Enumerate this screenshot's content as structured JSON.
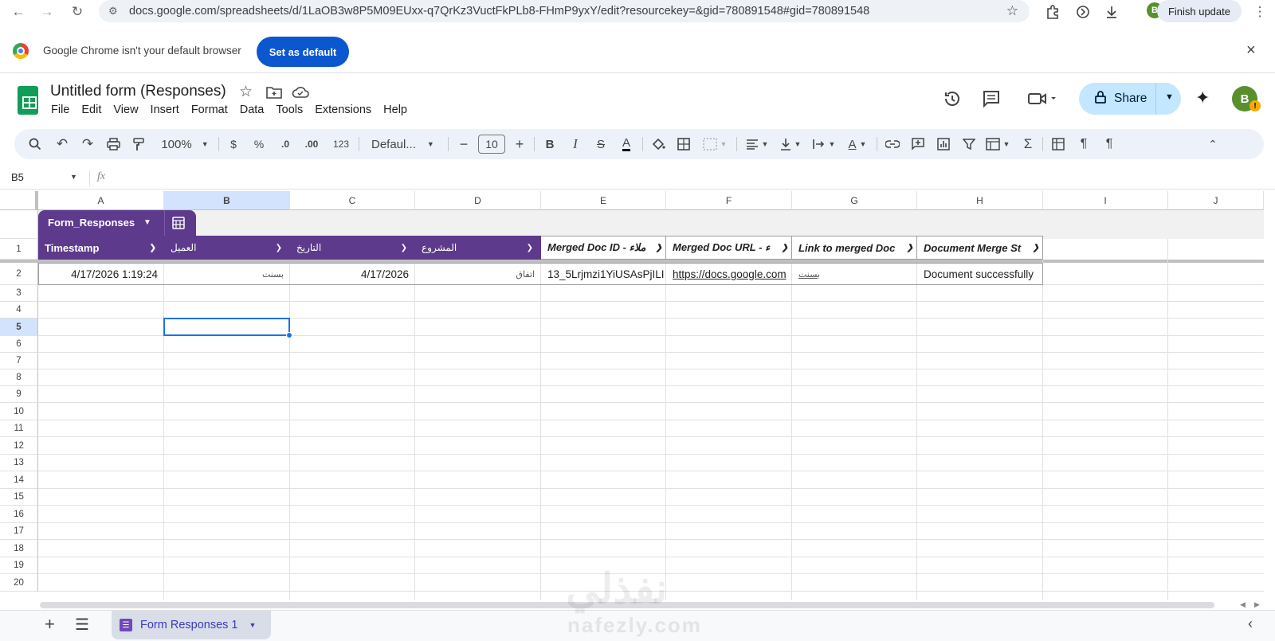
{
  "browser": {
    "url": "docs.google.com/spreadsheets/d/1LaOB3w8P5M09EUxx-q7QrKz3VuctFkPLb8-FHmP9yxY/edit?resourcekey=&gid=780891548#gid=780891548",
    "profile_initial": "B",
    "finish_update_label": "Finish update",
    "infobar_text": "Google Chrome isn't your default browser",
    "set_default_label": "Set as default"
  },
  "sheets": {
    "doc_title": "Untitled form (Responses)",
    "menu": [
      "File",
      "Edit",
      "View",
      "Insert",
      "Format",
      "Data",
      "Tools",
      "Extensions",
      "Help"
    ],
    "share_label": "Share",
    "user_initial": "B",
    "toolbar": {
      "zoom": "100%",
      "currency": "$",
      "percent": "%",
      "decrease_decimal": ".0",
      "increase_decimal": ".00",
      "number_format": "123",
      "font": "Defaul...",
      "font_size": "10",
      "bold": "B",
      "italic": "I",
      "text_color": "A"
    },
    "name_box": "B5",
    "fx_label": "fx"
  },
  "grid": {
    "columns": [
      "A",
      "B",
      "C",
      "D",
      "E",
      "F",
      "G",
      "H",
      "I",
      "J"
    ],
    "rows": [
      "1",
      "2",
      "3",
      "4",
      "5",
      "6",
      "7",
      "8",
      "9",
      "10",
      "11",
      "12",
      "13",
      "14",
      "15",
      "16",
      "17",
      "18",
      "19",
      "20"
    ],
    "table_name": "Form_Responses",
    "headers": [
      "Timestamp",
      "العميل",
      "التاريخ",
      "المشروع",
      "Merged Doc ID - ملاء",
      "Merged Doc URL - ء",
      "Link to merged Doc",
      "Document Merge St"
    ],
    "row2": [
      "4/17/2026 1:19:24",
      "بسنت",
      "4/17/2026",
      "اتفاق",
      "13_5Lrjmzi1YiUSAsPjILI",
      "https://docs.google.com",
      "بسنت",
      "Document successfully"
    ]
  },
  "footer": {
    "sheet_tab_label": "Form Responses 1"
  },
  "watermark": {
    "arabic": "نفذلي",
    "latin": "nafezly.com"
  },
  "colors": {
    "table_purple": "#5e3a8c",
    "share_bg": "#c2e7ff",
    "chrome_blue": "#0b57d0",
    "sheets_green": "#0f9d58",
    "selection_blue": "#1a73e8"
  }
}
